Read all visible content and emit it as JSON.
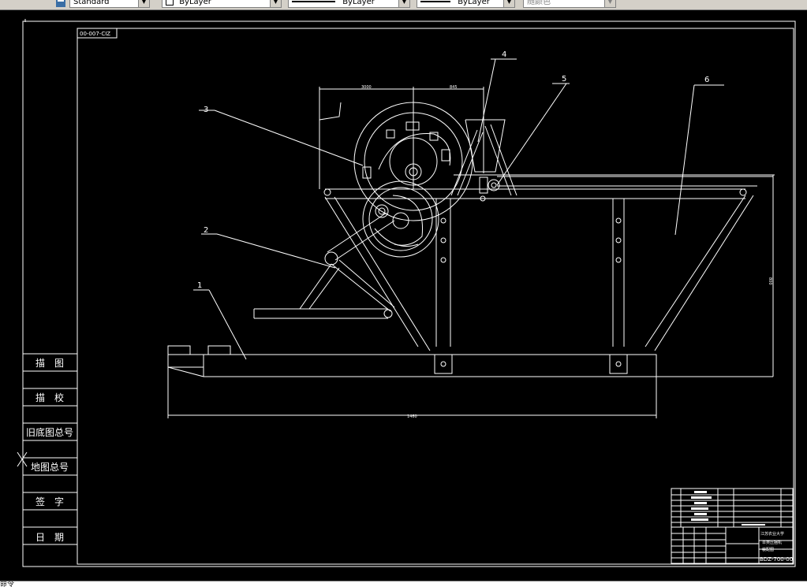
{
  "toolbar": {
    "text_style": "Standard",
    "layer": "ByLayer",
    "linetype": "ByLayer",
    "lineweight": "ByLayer",
    "plot_color": "随颜色"
  },
  "drawing": {
    "code_stamp": "00-007-CIZ",
    "title_code": "BDZ-700-00",
    "school": "江苏农业大学",
    "product": "草类压捆机",
    "drawing_kind": "装配图",
    "dim_width": "1460",
    "dim_height": "800",
    "dim_top_a": "3000",
    "dim_top_b": "845",
    "balloons": [
      "1",
      "2",
      "3",
      "4",
      "5",
      "6"
    ],
    "left_column": [
      "描　图",
      "描　校",
      "旧底图总号",
      "地图总号",
      "签　字",
      "日　期"
    ]
  },
  "cmd": {
    "text": "命令"
  }
}
